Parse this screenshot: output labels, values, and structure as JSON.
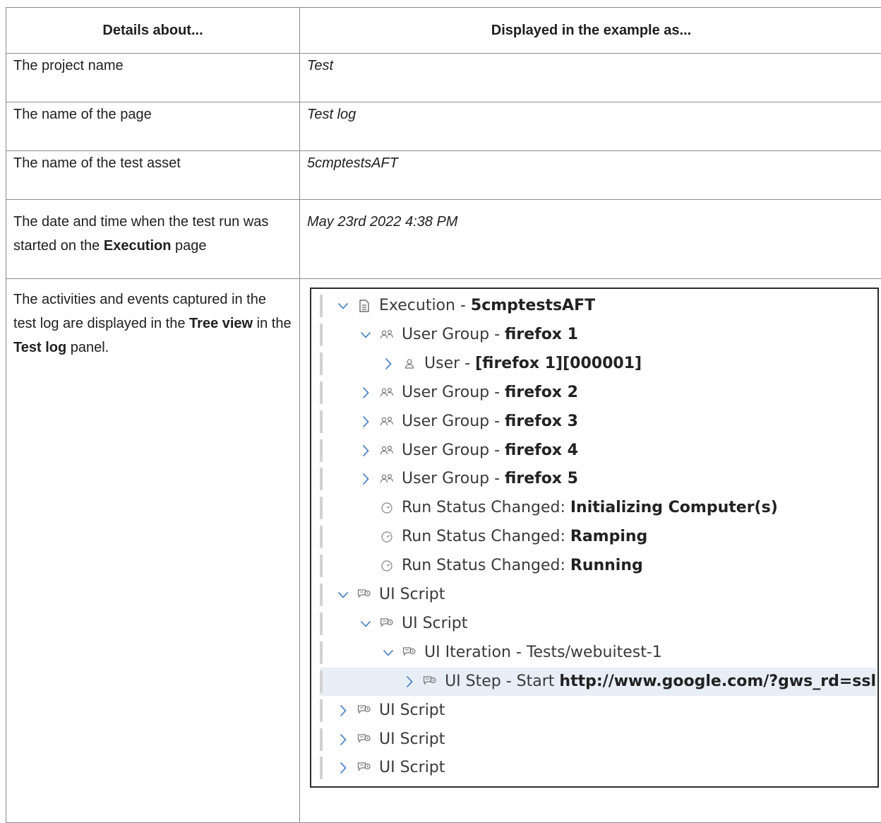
{
  "table": {
    "headers": [
      "Details about...",
      "Displayed in the example as..."
    ],
    "rows": [
      {
        "detail": "The project name",
        "value": "Test"
      },
      {
        "detail": "The name of the page",
        "value": "Test log"
      },
      {
        "detail": "The name of the test asset",
        "value": "5cmptestsAFT"
      },
      {
        "detail_pre": "The date and time when the test run was started on the ",
        "detail_bold": "Execution",
        "detail_post": " page",
        "value": "May 23rd 2022 4:38 PM"
      }
    ],
    "tree_row": {
      "t1": "The activities and events captured in the test log are displayed in the ",
      "b1": "Tree view",
      "t2": " in the ",
      "b2": "Test log",
      "t3": " panel."
    }
  },
  "tree": [
    {
      "indent": 0,
      "chevron": "down",
      "icon": "document-icon",
      "label": "Execution - ",
      "bold": "5cmptestsAFT"
    },
    {
      "indent": 1,
      "chevron": "down",
      "icon": "user-group-icon",
      "label": "User Group - ",
      "bold": "firefox 1"
    },
    {
      "indent": 2,
      "chevron": "right",
      "icon": "user-icon",
      "label": "User - ",
      "bold": "[firefox 1][000001]"
    },
    {
      "indent": 1,
      "chevron": "right",
      "icon": "user-group-icon",
      "label": "User Group - ",
      "bold": "firefox 2"
    },
    {
      "indent": 1,
      "chevron": "right",
      "icon": "user-group-icon",
      "label": "User Group - ",
      "bold": "firefox 3"
    },
    {
      "indent": 1,
      "chevron": "right",
      "icon": "user-group-icon",
      "label": "User Group - ",
      "bold": "firefox 4"
    },
    {
      "indent": 1,
      "chevron": "right",
      "icon": "user-group-icon",
      "label": "User Group - ",
      "bold": "firefox 5"
    },
    {
      "indent": 1,
      "chevron": "none",
      "icon": "run-status-icon",
      "label": "Run Status Changed: ",
      "bold": "Initializing Computer(s)"
    },
    {
      "indent": 1,
      "chevron": "none",
      "icon": "run-status-icon",
      "label": "Run Status Changed: ",
      "bold": "Ramping"
    },
    {
      "indent": 1,
      "chevron": "none",
      "icon": "run-status-icon",
      "label": "Run Status Changed: ",
      "bold": "Running"
    },
    {
      "indent": 0,
      "chevron": "down",
      "icon": "ui-script-icon",
      "label": "UI Script",
      "bold": ""
    },
    {
      "indent": 1,
      "chevron": "down",
      "icon": "ui-script-icon",
      "label": "UI Script",
      "bold": ""
    },
    {
      "indent": 2,
      "chevron": "down",
      "icon": "ui-script-icon",
      "label": "UI Iteration - Tests/webuitest-1",
      "bold": ""
    },
    {
      "indent": 3,
      "chevron": "right",
      "icon": "ui-script-icon",
      "label": "UI Step - Start ",
      "bold": "http://www.google.com/?gws_rd=ssl",
      "selected": true
    },
    {
      "indent": 0,
      "chevron": "right",
      "icon": "ui-script-icon",
      "label": "UI Script",
      "bold": ""
    },
    {
      "indent": 0,
      "chevron": "right",
      "icon": "ui-script-icon",
      "label": "UI Script",
      "bold": ""
    },
    {
      "indent": 0,
      "chevron": "right",
      "icon": "ui-script-icon",
      "label": "UI Script",
      "bold": ""
    }
  ]
}
